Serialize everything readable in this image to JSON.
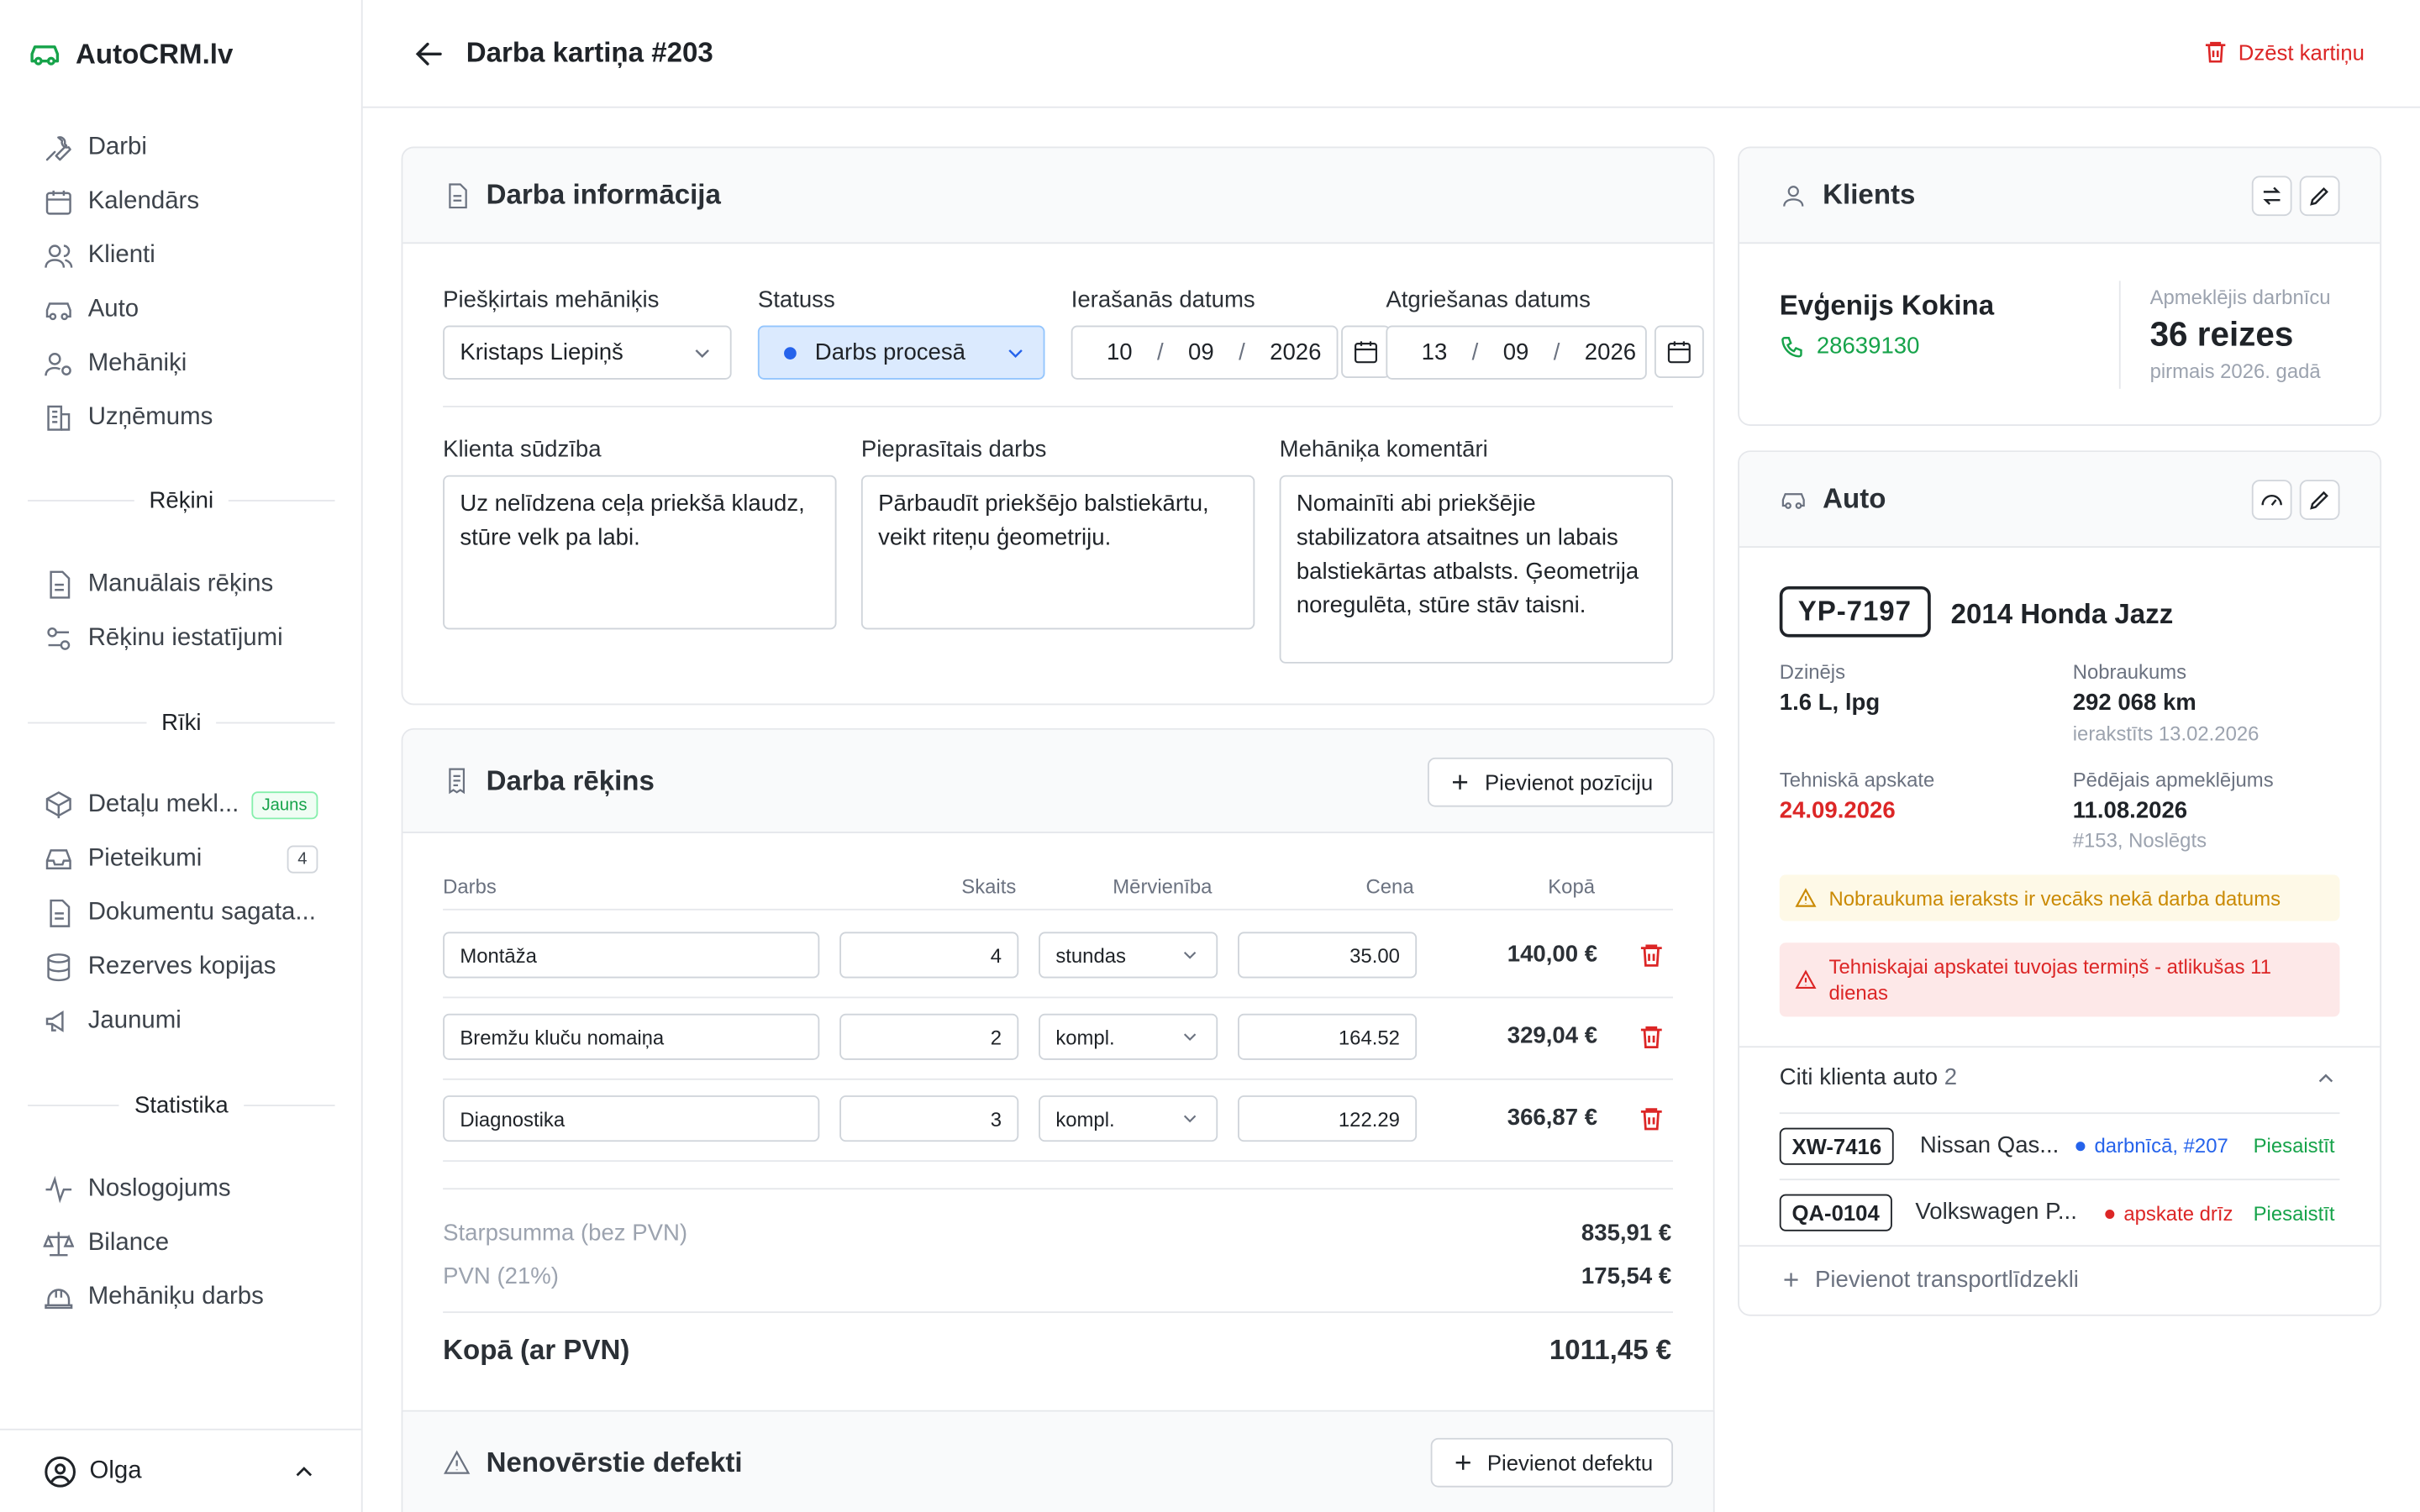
{
  "app": {
    "name": "AutoCRM.lv"
  },
  "sidebar": {
    "main_items": [
      {
        "label": "Darbi",
        "icon": "wrench-icon"
      },
      {
        "label": "Kalendārs",
        "icon": "calendar-icon"
      },
      {
        "label": "Klienti",
        "icon": "users-icon"
      },
      {
        "label": "Auto",
        "icon": "car-icon"
      },
      {
        "label": "Mehāniķi",
        "icon": "mechanic-icon"
      },
      {
        "label": "Uzņēmums",
        "icon": "building-icon"
      }
    ],
    "sections": {
      "invoices": "Rēķini",
      "tools": "Rīki",
      "stats": "Statistika"
    },
    "invoice_items": [
      {
        "label": "Manuālais rēķins"
      },
      {
        "label": "Rēķinu iestatījumi"
      }
    ],
    "tool_items": [
      {
        "label": "Detaļu mekl...",
        "badge": "Jauns"
      },
      {
        "label": "Pieteikumi",
        "badge": "4"
      },
      {
        "label": "Dokumentu sagata..."
      },
      {
        "label": "Rezerves kopijas"
      },
      {
        "label": "Jaunumi"
      }
    ],
    "stat_items": [
      {
        "label": "Noslogojums"
      },
      {
        "label": "Bilance"
      },
      {
        "label": "Mehāniķu darbs"
      }
    ],
    "user": "Olga"
  },
  "header": {
    "title": "Darba kartiņa #203",
    "delete_label": "Dzēst kartiņu"
  },
  "work_info": {
    "title": "Darba informācija",
    "mechanic_label": "Piešķirtais mehāniķis",
    "mechanic_value": "Kristaps Liepiņš",
    "status_label": "Statuss",
    "status_value": "Darbs procesā",
    "arrival_label": "Ierašanās datums",
    "arrival": {
      "d": "10",
      "m": "09",
      "y": "2026"
    },
    "return_label": "Atgriešanas datums",
    "return": {
      "d": "13",
      "m": "09",
      "y": "2026"
    },
    "complaint_label": "Klienta sūdzība",
    "complaint": "Uz nelīdzena ceļa priekšā klaudz, stūre velk pa labi.",
    "requested_label": "Pieprasītais darbs",
    "requested": "Pārbaudīt priekšējo balstiekārtu, veikt riteņu ģeometriju.",
    "comments_label": "Mehāniķa komentāri",
    "comments": "Nomainīti abi priekšējie stabilizatora atsaitnes un labais balstiekārtas atbalsts. Ģeometrija noregulēta, stūre stāv taisni."
  },
  "invoice": {
    "title": "Darba rēķins",
    "add_label": "Pievienot pozīciju",
    "columns": {
      "work": "Darbs",
      "qty": "Skaits",
      "unit": "Mērvienība",
      "price": "Cena",
      "total": "Kopā"
    },
    "rows": [
      {
        "work": "Montāža",
        "qty": "4",
        "unit": "stundas",
        "price": "35.00",
        "total": "140,00 €"
      },
      {
        "work": "Bremžu kluču nomaiņa",
        "qty": "2",
        "unit": "kompl.",
        "price": "164.52",
        "total": "329,04 €"
      },
      {
        "work": "Diagnostika",
        "qty": "3",
        "unit": "kompl.",
        "price": "122.29",
        "total": "366,87 €"
      }
    ],
    "subtotal_label": "Starpsumma (bez PVN)",
    "subtotal": "835,91 €",
    "vat_label": "PVN (21%)",
    "vat": "175,54 €",
    "total_label": "Kopā (ar PVN)",
    "total": "1011,45 €"
  },
  "defects": {
    "title": "Nenovērstie defekti",
    "add_label": "Pievienot defektu"
  },
  "client": {
    "title": "Klients",
    "name": "Evģenijs Kokina",
    "phone": "28639130",
    "visits_label": "Apmeklējis darbnīcu",
    "visits": "36 reizes",
    "visits_since": "pirmais 2026. gadā"
  },
  "auto": {
    "title": "Auto",
    "plate": "YP-7197",
    "name": "2014 Honda Jazz",
    "engine_label": "Dzinējs",
    "engine": "1.6 L, lpg",
    "mileage_label": "Nobraukums",
    "mileage": "292 068 km",
    "mileage_note": "ierakstīts 13.02.2026",
    "inspection_label": "Tehniskā apskate",
    "inspection": "24.09.2026",
    "last_visit_label": "Pēdējais apmeklējums",
    "last_visit": "11.08.2026",
    "last_visit_note": "#153, Noslēgts",
    "warning": "Nobraukuma ieraksts ir vecāks nekā darba datums",
    "error": "Tehniskajai apskatei tuvojas termiņš - atlikušas 11 dienas",
    "others_label": "Citi klienta auto",
    "others_count": "2",
    "others": [
      {
        "plate": "XW-7416",
        "name": "Nissan Qas...",
        "status": "darbnīcā, #207",
        "status_color": "#2563eb",
        "action": "Piesaistīt"
      },
      {
        "plate": "QA-0104",
        "name": "Volkswagen P...",
        "status": "apskate drīz",
        "status_color": "#dc2626",
        "action": "Piesaistīt"
      }
    ],
    "add_vehicle": "Pievienot transportlīdzekli"
  }
}
